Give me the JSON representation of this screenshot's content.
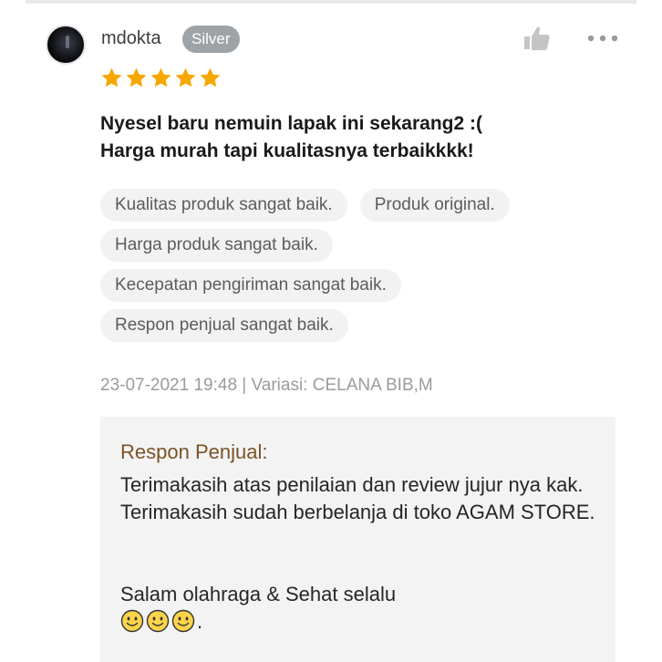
{
  "review": {
    "username": "mdokta",
    "badge": "Silver",
    "rating": 5,
    "text": "Nyesel baru nemuin lapak ini sekarang2 :(\nHarga murah tapi kualitasnya terbaikkkk!",
    "tags": [
      [
        "Kualitas produk sangat baik.",
        "Produk original."
      ],
      [
        "Harga produk sangat baik."
      ],
      [
        "Kecepatan pengiriman sangat baik."
      ],
      [
        "Respon penjual sangat baik."
      ]
    ],
    "meta": "23-07-2021 19:48 | Variasi: CELANA BIB,M",
    "icons": {
      "like": "thumbs-up-icon",
      "more": "more-options-icon",
      "star": "star-icon",
      "emoji": "smiley-face-icon"
    }
  },
  "seller_response": {
    "title": "Respon Penjual:",
    "text": "Terimakasih atas penilaian dan review jujur nya kak.\nTerimakasih sudah berbelanja di toko AGAM STORE.",
    "closing": "Salam olahraga & Sehat selalu",
    "emoji_count": 3,
    "closing_end": "."
  },
  "colors": {
    "star": "#f6a700",
    "badge_bg": "#9ea3a8",
    "seller_title": "#7a5327",
    "seller_bg": "#f3f3f3",
    "tag_bg": "#f2f2f2"
  }
}
